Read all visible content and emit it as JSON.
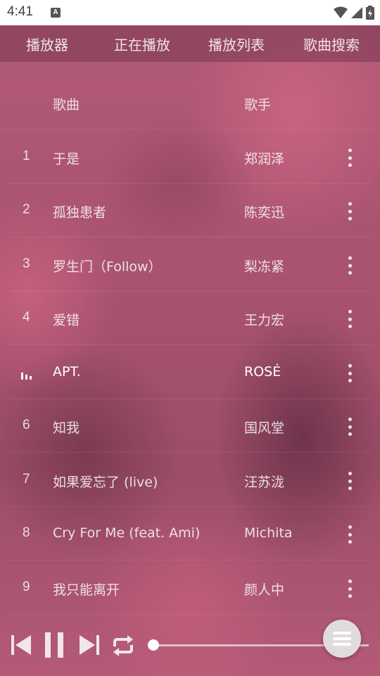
{
  "status_bar": {
    "time": "4:41",
    "notification_icon": "A"
  },
  "nav": {
    "tabs": [
      "播放器",
      "正在播放",
      "播放列表",
      "歌曲搜索"
    ]
  },
  "list_header": {
    "song": "歌曲",
    "artist": "歌手"
  },
  "songs": [
    {
      "num": "1",
      "title": "于是",
      "artist": "郑润泽"
    },
    {
      "num": "2",
      "title": "孤独患者",
      "artist": "陈奕迅"
    },
    {
      "num": "3",
      "title": "罗生门（Follow）",
      "artist": "梨冻紧"
    },
    {
      "num": "4",
      "title": "爱错",
      "artist": "王力宏"
    },
    {
      "num": "",
      "title": "APT.",
      "artist": "ROSÉ",
      "playing": true
    },
    {
      "num": "6",
      "title": "知我",
      "artist": "国风堂"
    },
    {
      "num": "7",
      "title": "如果爱忘了 (live)",
      "artist": "汪苏泷"
    },
    {
      "num": "8",
      "title": "Cry For Me (feat. Ami)",
      "artist": "Michita"
    },
    {
      "num": "9",
      "title": "我只能离开",
      "artist": "颜人中"
    }
  ],
  "player": {
    "progress": 0.02,
    "icons": [
      "skip-previous-icon",
      "pause-icon",
      "skip-next-icon",
      "repeat-icon",
      "menu-icon"
    ]
  },
  "colors": {
    "accent": "#ffffff",
    "background": "#a8566f",
    "nav_background": "#7a3850"
  }
}
